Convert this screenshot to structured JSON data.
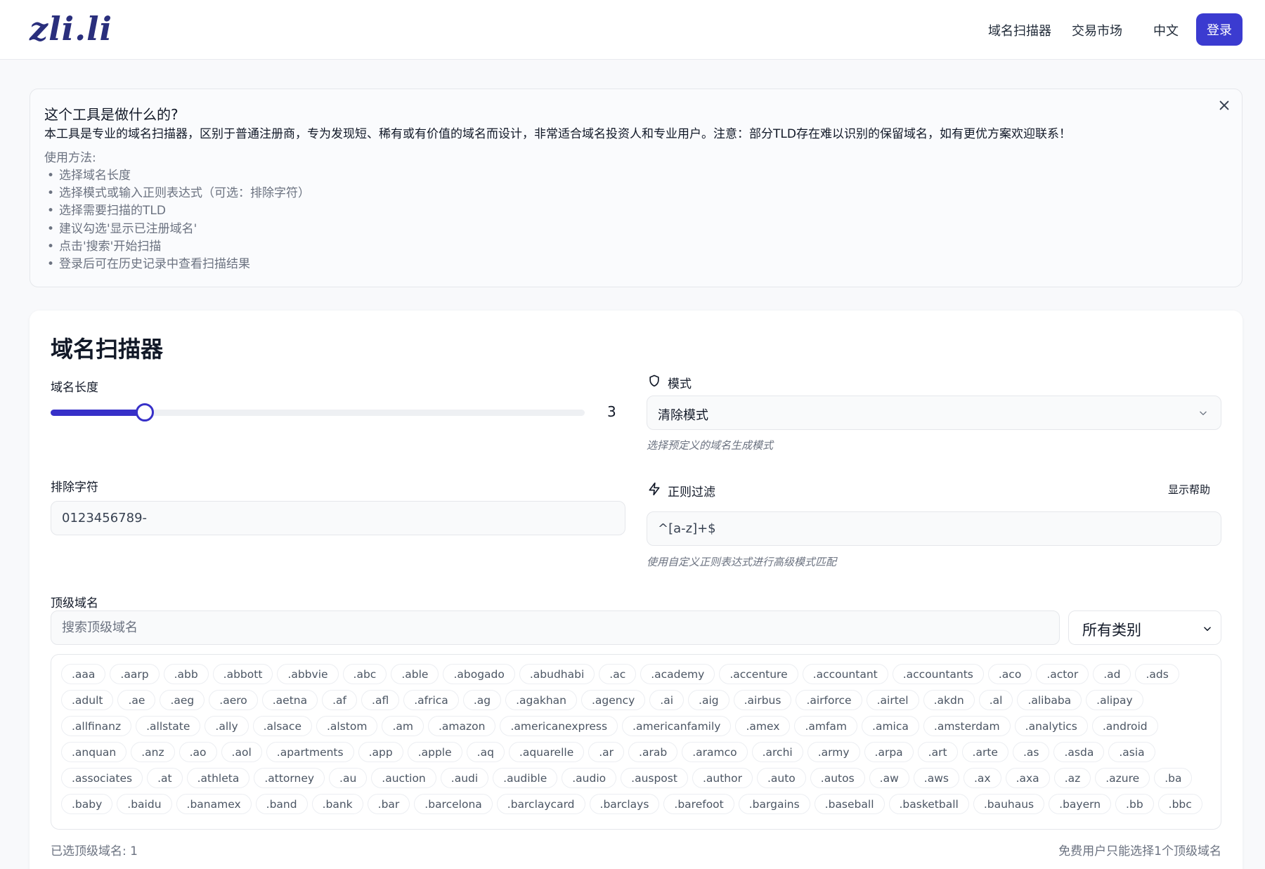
{
  "header": {
    "logo": "zli.li",
    "nav": [
      "域名扫描器",
      "交易市场"
    ],
    "language": "中文",
    "login": "登录"
  },
  "info": {
    "title": "这个工具是做什么的?",
    "description": "本工具是专业的域名扫描器，区别于普通注册商，专为发现短、稀有或有价值的域名而设计，非常适合域名投资人和专业用户。注意：部分TLD存在难以识别的保留域名，如有更优方案欢迎联系！",
    "usage_title": "使用方法:",
    "steps": [
      "选择域名长度",
      "选择模式或输入正则表达式（可选：排除字符）",
      "选择需要扫描的TLD",
      "建议勾选'显示已注册域名'",
      "点击'搜索'开始扫描",
      "登录后可在历史记录中查看扫描结果"
    ]
  },
  "scanner": {
    "title": "域名扫描器",
    "length_label": "域名长度",
    "length_value": "3",
    "length_fraction": 0.176,
    "mode_label": "模式",
    "mode_value": "清除模式",
    "mode_hint": "选择预定义的域名生成模式",
    "exclude_label": "排除字符",
    "exclude_value": "0123456789-",
    "regex_label": "正则过滤",
    "regex_help": "显示帮助",
    "regex_value": "^[a-z]+$",
    "regex_hint": "使用自定义正则表达式进行高级模式匹配",
    "tld_label": "顶级域名",
    "tld_search_placeholder": "搜索顶级域名",
    "category_value": "所有类别",
    "selected_count": "已选顶级域名: 1",
    "limit_note": "免费用户只能选择1个顶级域名",
    "accent_color": "#3730c8"
  },
  "tlds": [
    ".aaa",
    ".aarp",
    ".abb",
    ".abbott",
    ".abbvie",
    ".abc",
    ".able",
    ".abogado",
    ".abudhabi",
    ".ac",
    ".academy",
    ".accenture",
    ".accountant",
    ".accountants",
    ".aco",
    ".actor",
    ".ad",
    ".ads",
    ".adult",
    ".ae",
    ".aeg",
    ".aero",
    ".aetna",
    ".af",
    ".afl",
    ".africa",
    ".ag",
    ".agakhan",
    ".agency",
    ".ai",
    ".aig",
    ".airbus",
    ".airforce",
    ".airtel",
    ".akdn",
    ".al",
    ".alibaba",
    ".alipay",
    ".allfinanz",
    ".allstate",
    ".ally",
    ".alsace",
    ".alstom",
    ".am",
    ".amazon",
    ".americanexpress",
    ".americanfamily",
    ".amex",
    ".amfam",
    ".amica",
    ".amsterdam",
    ".analytics",
    ".android",
    ".anquan",
    ".anz",
    ".ao",
    ".aol",
    ".apartments",
    ".app",
    ".apple",
    ".aq",
    ".aquarelle",
    ".ar",
    ".arab",
    ".aramco",
    ".archi",
    ".army",
    ".arpa",
    ".art",
    ".arte",
    ".as",
    ".asda",
    ".asia",
    ".associates",
    ".at",
    ".athleta",
    ".attorney",
    ".au",
    ".auction",
    ".audi",
    ".audible",
    ".audio",
    ".auspost",
    ".author",
    ".auto",
    ".autos",
    ".aw",
    ".aws",
    ".ax",
    ".axa",
    ".az",
    ".azure",
    ".ba",
    ".baby",
    ".baidu",
    ".banamex",
    ".band",
    ".bank",
    ".bar",
    ".barcelona",
    ".barclaycard",
    ".barclays",
    ".barefoot",
    ".bargains",
    ".baseball",
    ".basketball",
    ".bauhaus",
    ".bayern",
    ".bb",
    ".bbc"
  ]
}
